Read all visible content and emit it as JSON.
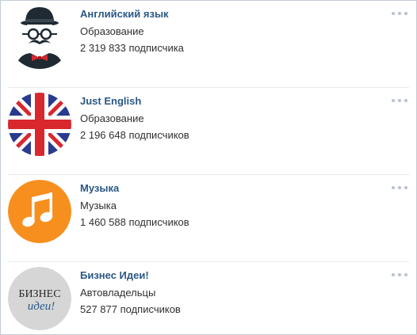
{
  "groups": [
    {
      "name": "Английский язык",
      "category": "Образование",
      "subscribers": "2 319 833 подписчика",
      "avatar_icon": "gentleman-mustache-icon"
    },
    {
      "name": "Just English",
      "category": "Образование",
      "subscribers": "2 196 648 подписчиков",
      "avatar_icon": "union-jack-flag-icon"
    },
    {
      "name": "Музыка",
      "category": "Музыка",
      "subscribers": "1 460 588 подписчиков",
      "avatar_icon": "music-note-icon"
    },
    {
      "name": "Бизнес Идеи!",
      "category": "Автовладельцы",
      "subscribers": "527 877 подписчиков",
      "avatar_icon": "business-ideas-logo",
      "logo_text": [
        "БИЗНЕС",
        "идеи!"
      ]
    }
  ],
  "colors": {
    "link": "#2a5885",
    "text": "#2f3033",
    "music_orange": "#f78f1e",
    "flag_blue": "#2a3b8f",
    "flag_red": "#d9272e"
  }
}
